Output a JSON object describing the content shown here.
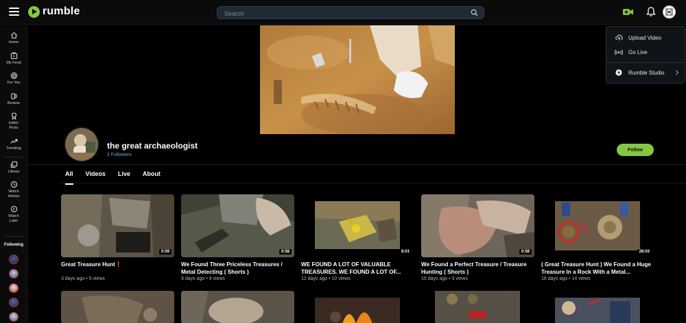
{
  "brand": {
    "name": "rumble",
    "accent": "#85c742"
  },
  "search": {
    "placeholder": "Search"
  },
  "sidebar": {
    "items": [
      {
        "label": "Home",
        "icon": "home-icon"
      },
      {
        "label": "My Feed",
        "icon": "feed-icon"
      },
      {
        "label": "For You",
        "icon": "for-you-icon"
      },
      {
        "label": "Browse",
        "icon": "browse-icon"
      },
      {
        "label": "Editor Picks",
        "icon": "editor-picks-icon"
      },
      {
        "label": "Trending",
        "icon": "trending-icon"
      },
      {
        "label": "Library",
        "icon": "library-icon"
      },
      {
        "label": "Watch History",
        "icon": "history-icon"
      },
      {
        "label": "Watch Later",
        "icon": "watch-later-icon"
      }
    ],
    "following_title": "Following"
  },
  "upload_menu": {
    "items": [
      {
        "label": "Upload Video",
        "icon": "upload-icon"
      },
      {
        "label": "Go Live",
        "icon": "live-icon"
      },
      {
        "label": "Rumble Studio",
        "icon": "studio-icon"
      }
    ]
  },
  "channel": {
    "name": "the great archaeologist",
    "followers": "2 Followers",
    "follow_label": "Follow"
  },
  "tabs": [
    {
      "label": "All",
      "active": true
    },
    {
      "label": "Videos",
      "active": false
    },
    {
      "label": "Live",
      "active": false
    },
    {
      "label": "About",
      "active": false
    }
  ],
  "videos": [
    {
      "title": "Great Treasure Hunt❗",
      "duration": "0:59",
      "meta": "3 days ago • 5 views"
    },
    {
      "title": "We Found Three Priceless Treasures / Metal Detecting ( Shorts )",
      "duration": "0:58",
      "meta": "9 days ago • 9 views"
    },
    {
      "title": "WE FOUND A LOT OF VALUABLE TREASURES. WE FOUND A LOT OF...",
      "duration": "8:01",
      "meta": "12 days ago • 10 views"
    },
    {
      "title": "We Found a Perfect Treasure / Treasure Hunting ( Shorts )",
      "duration": "0:58",
      "meta": "15 days ago • 3 views"
    },
    {
      "title": "( Great Treasure Hunt ) We Found a Huge Treasure In a Rock With a Metal...",
      "duration": "28:03",
      "meta": "16 days ago • 14 views"
    }
  ]
}
